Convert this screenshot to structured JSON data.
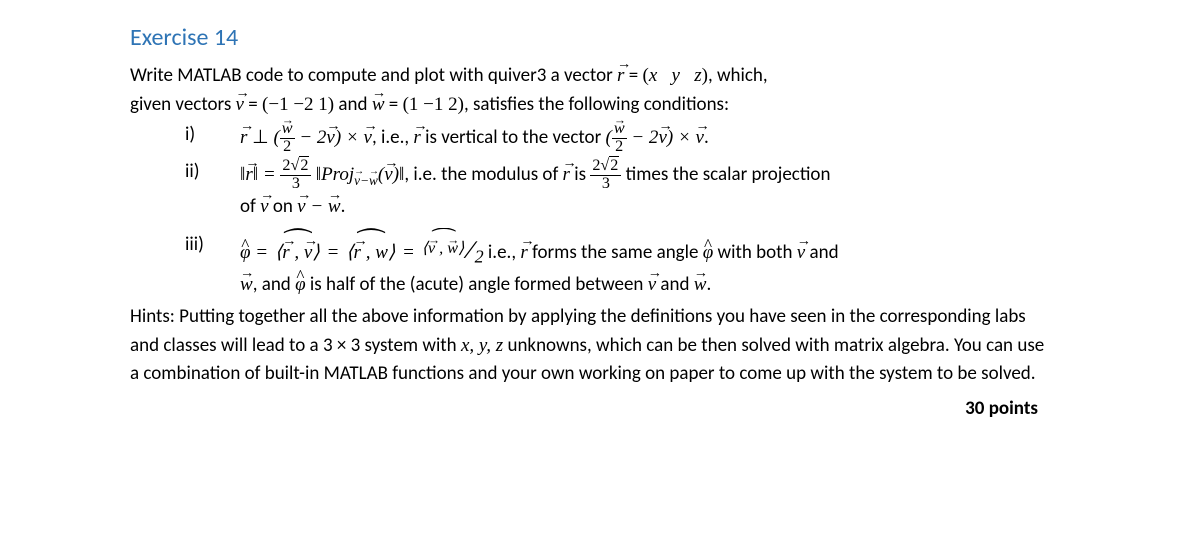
{
  "title": "Exercise 14",
  "intro_line1_a": "Write MATLAB code to compute and plot with quiver3 a vector ",
  "intro_line1_r": "r",
  "intro_line1_b": " = ",
  "intro_matrix1_open": "(",
  "intro_matrix1_x": "x",
  "intro_matrix1_y": "y",
  "intro_matrix1_z": "z",
  "intro_matrix1_close": ")",
  "intro_line1_c": ", which,",
  "intro_line2_a": "given vectors ",
  "intro_v": "v",
  "intro_line2_b": " = ",
  "intro_matrix2": "(−1   −2    1)",
  "intro_line2_c": " and ",
  "intro_w": "w",
  "intro_line2_d": " = ",
  "intro_matrix3": "(1   −1    2)",
  "intro_line2_e": ", satisfies the following conditions:",
  "items": {
    "i": {
      "label": "i)",
      "p1": " ⊥ ",
      "p2": " − 2",
      "p3": ") × ",
      "p4": ", i.e., ",
      "p5": " is vertical to the vector ",
      "p6": " − 2",
      "p7": ") × ",
      "p8": "."
    },
    "ii": {
      "label": "ii)",
      "norm1": "‖",
      "norm2": "‖",
      "eq": " = ",
      "frac_num": "2",
      "sqrt_val": "2",
      "frac_den": "3",
      "proj_text": "Proj",
      "proj_sub_a": "−",
      "open_paren": "(",
      "close_paren": ")",
      "mid": ", i.e. the modulus of ",
      "mid2": " is ",
      "tail": " times the scalar projection",
      "line2_a": "of ",
      "line2_b": " on ",
      "line2_c": " − ",
      "line2_d": "."
    },
    "iii": {
      "label": "iii)",
      "phi": "φ",
      "eq1": " = ",
      "comma": " , ",
      "eq2": " = ",
      "eq3": " = ",
      "slashfrac_den": "2",
      "mid_a": " i.e., ",
      "mid_b": " forms the same angle ",
      "mid_c": " with both ",
      "mid_d": " and",
      "line2_a": ", and ",
      "line2_b": " is half of the (acute) angle formed between ",
      "line2_c": " and ",
      "line2_d": "."
    }
  },
  "hints_text": "Hints: Putting together all the above information by applying the definitions you have seen in the corresponding labs and classes will lead to a 3 × 3 system with ",
  "hints_xyz": "x, y, z",
  "hints_text2": " unknowns, which can be then solved with matrix algebra. You can use a combination of built-in MATLAB functions and your own working on paper to come up with the system to be solved.",
  "points": "30 points"
}
